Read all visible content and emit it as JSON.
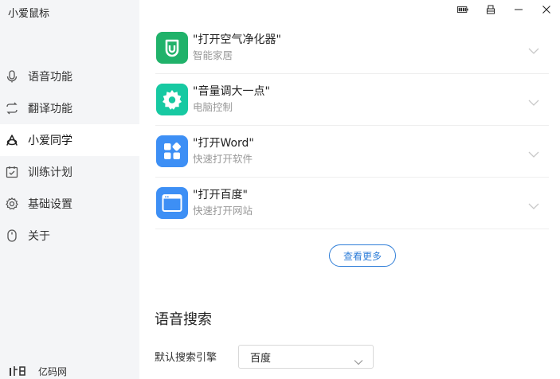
{
  "app": {
    "title": "小爱鼠标"
  },
  "sidebar": {
    "items": [
      {
        "label": "语音功能",
        "icon": "mic-icon",
        "active": false
      },
      {
        "label": "翻译功能",
        "icon": "translate-icon",
        "active": false
      },
      {
        "label": "小爱同学",
        "icon": "xiaoai-icon",
        "active": true
      },
      {
        "label": "训练计划",
        "icon": "calendar-icon",
        "active": false
      },
      {
        "label": "基础设置",
        "icon": "gear-icon",
        "active": false
      },
      {
        "label": "关于",
        "icon": "mouse-icon",
        "active": false
      }
    ],
    "brand": "亿码网"
  },
  "commands": [
    {
      "title": "\"打开空气净化器\"",
      "subtitle": "智能家居",
      "icon": "mi-home-icon",
      "color": "#20b26a"
    },
    {
      "title": "\"音量调大一点\"",
      "subtitle": "电脑控制",
      "icon": "gear-icon",
      "color": "#17c9a2"
    },
    {
      "title": "\"打开Word\"",
      "subtitle": "快速打开软件",
      "icon": "apps-icon",
      "color": "#3d8ff5"
    },
    {
      "title": "\"打开百度\"",
      "subtitle": "快速打开网站",
      "icon": "browser-icon",
      "color": "#3d8ff5"
    }
  ],
  "more_button": "查看更多",
  "voice_search": {
    "title": "语音搜索",
    "engine_label": "默认搜索引擎",
    "engine_value": "百度"
  },
  "colors": {
    "accent": "#2f7ed8",
    "sidebar_bg": "#f4f5f7"
  }
}
